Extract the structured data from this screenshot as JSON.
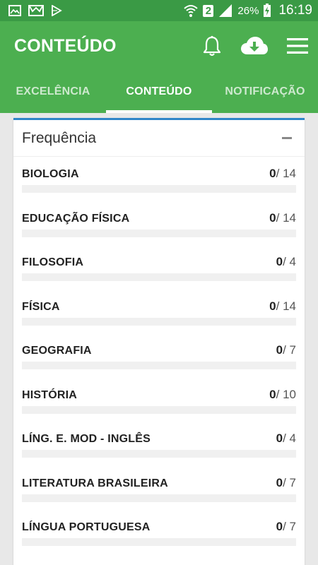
{
  "status_bar": {
    "icons_left": [
      "gallery-icon",
      "mail-icon",
      "play-store-icon"
    ],
    "sim": "2",
    "battery": "26%",
    "time": "16:19"
  },
  "app_bar": {
    "title": "CONTEÚDO",
    "actions": [
      "bell-icon",
      "cloud-download-icon",
      "menu-icon"
    ]
  },
  "tabs": [
    {
      "label": "EXCELÊNCIA",
      "active": false
    },
    {
      "label": "CONTEÚDO",
      "active": true
    },
    {
      "label": "NOTIFICAÇÃO",
      "active": false
    }
  ],
  "card": {
    "title": "Frequência",
    "subjects": [
      {
        "name": "BIOLOGIA",
        "done": "0",
        "total": "/ 14",
        "progress": 0
      },
      {
        "name": "EDUCAÇÃO FÍSICA",
        "done": "0",
        "total": "/ 14",
        "progress": 0
      },
      {
        "name": "FILOSOFIA",
        "done": "0",
        "total": "/ 4",
        "progress": 0
      },
      {
        "name": "FÍSICA",
        "done": "0",
        "total": "/ 14",
        "progress": 0
      },
      {
        "name": "GEOGRAFIA",
        "done": "0",
        "total": "/ 7",
        "progress": 0
      },
      {
        "name": "HISTÓRIA",
        "done": "0",
        "total": "/ 10",
        "progress": 0
      },
      {
        "name": "LÍNG. E. MOD - INGLÊS",
        "done": "0",
        "total": "/ 4",
        "progress": 0
      },
      {
        "name": "LITERATURA BRASILEIRA",
        "done": "0",
        "total": "/ 7",
        "progress": 0
      },
      {
        "name": "LÍNGUA PORTUGUESA",
        "done": "0",
        "total": "/ 7",
        "progress": 0
      }
    ]
  },
  "colors": {
    "primary": "#4caf50",
    "status_bar": "#3a9a45",
    "card_accent": "#2f86c8"
  }
}
